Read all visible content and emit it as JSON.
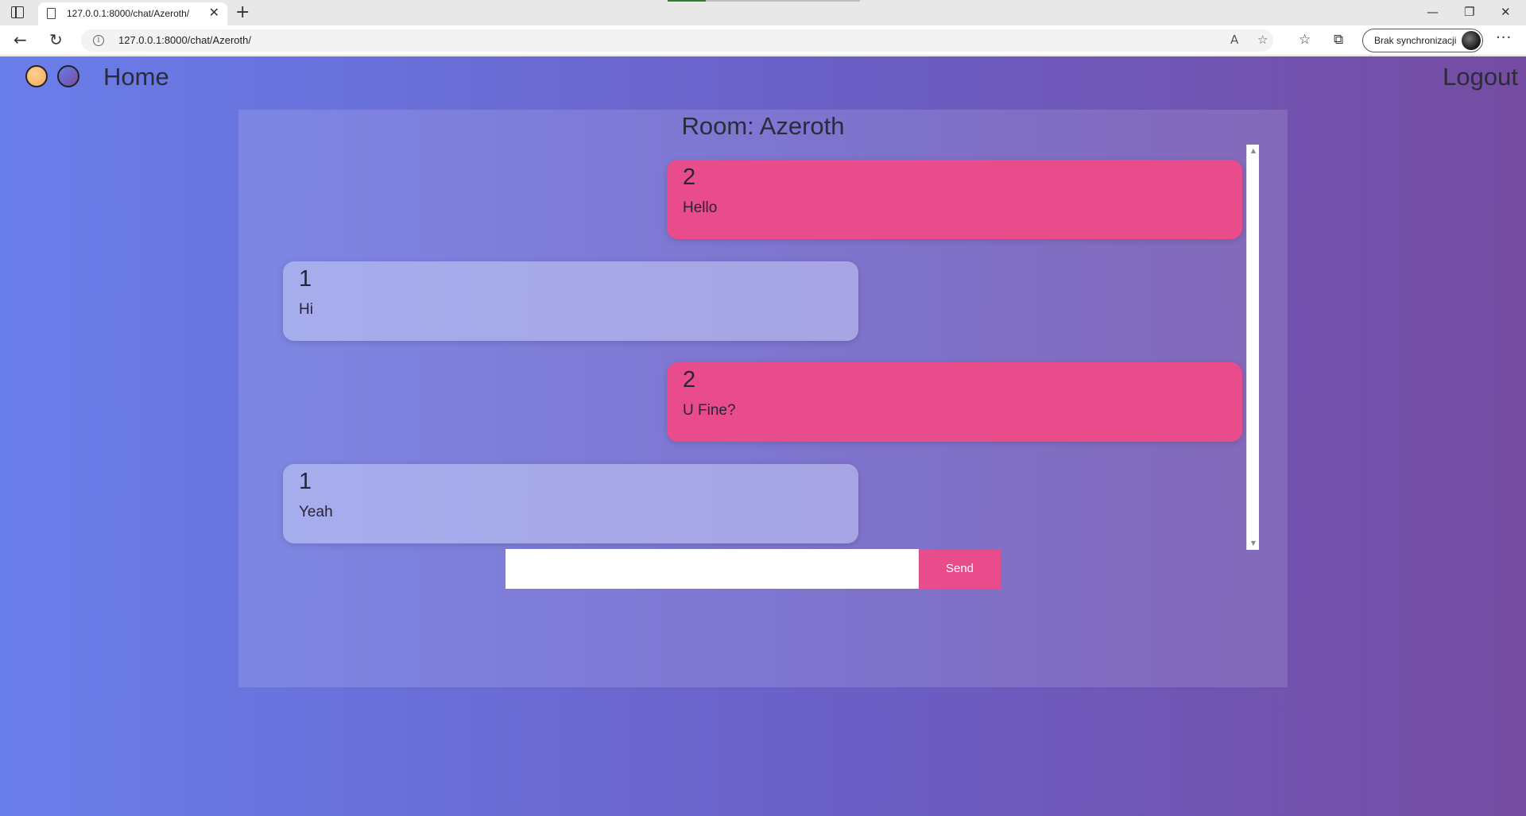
{
  "browser": {
    "tab_title": "127.0.0.1:8000/chat/Azeroth/",
    "tab_close": "✕",
    "new_tab": "+",
    "url": "127.0.0.1:8000/chat/Azeroth/",
    "info_icon": "i",
    "profile_label": "Brak synchronizacji",
    "window_minimize": "—",
    "window_restore": "❐",
    "window_close": "✕",
    "back": "←",
    "reload": "↻",
    "read_aloud": "A",
    "favorite_add": "☆",
    "favorites": "☆",
    "collections": "⧉",
    "more": "···"
  },
  "nav": {
    "home": "Home",
    "logout": "Logout"
  },
  "room": {
    "title": "Room: Azeroth"
  },
  "messages": [
    {
      "user": "2",
      "text": "Hello",
      "side": "right"
    },
    {
      "user": "1",
      "text": "Hi",
      "side": "left"
    },
    {
      "user": "2",
      "text": "U Fine?",
      "side": "right"
    },
    {
      "user": "1",
      "text": "Yeah",
      "side": "left"
    }
  ],
  "composer": {
    "value": "",
    "send_label": "Send"
  },
  "colors": {
    "accent": "#e94c8b",
    "gradient_start": "#6a7eea",
    "gradient_end": "#764ba2"
  }
}
